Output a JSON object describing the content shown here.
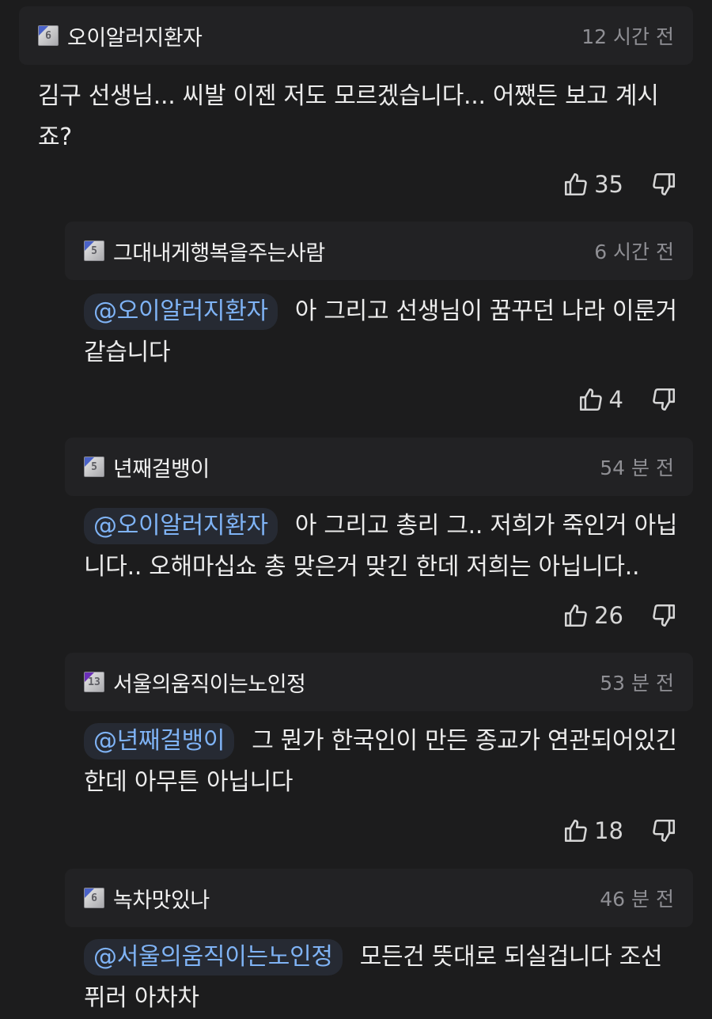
{
  "comments": [
    {
      "level": "6",
      "author": "오이알러지환자",
      "time": "12 시간 전",
      "mention": "",
      "text_line1": "김구 선생님... 씨발 이젠 저도 모르겠습니다... 어쨌든 보고 계시",
      "text_line2": "죠?",
      "likes": "35"
    },
    {
      "level": "5",
      "author": "그대내게행복을주는사람",
      "time": "6 시간 전",
      "mention": "@오이알러지환자",
      "text_line1": "아 그리고 선생님이 꿈꾸던 나라 이룬거",
      "text_line2": "같습니다",
      "likes": "4"
    },
    {
      "level": "5",
      "author": "년째걸뱅이",
      "time": "54 분 전",
      "mention": "@오이알러지환자",
      "text_line1": "아 그리고 총리 그.. 저희가 죽인거 아닙",
      "text_line2": "니다.. 오해마십쇼 총 맞은거 맞긴 한데 저희는 아닙니다..",
      "likes": "26"
    },
    {
      "level": "13",
      "author": "서울의움직이는노인정",
      "time": "53 분 전",
      "mention": "@년째걸뱅이",
      "text_line1": "그 뭔가 한국인이 만든 종교가 연관되어있긴",
      "text_line2": "한데 아무튼 아닙니다",
      "likes": "18"
    },
    {
      "level": "6",
      "author": "녹차맛있나",
      "time": "46 분 전",
      "mention": "@서울의움직이는노인정",
      "text_line1": "모든건 뜻대로 되실겁니다 조선",
      "text_line2": "퓌러 아차차",
      "likes": ""
    }
  ]
}
